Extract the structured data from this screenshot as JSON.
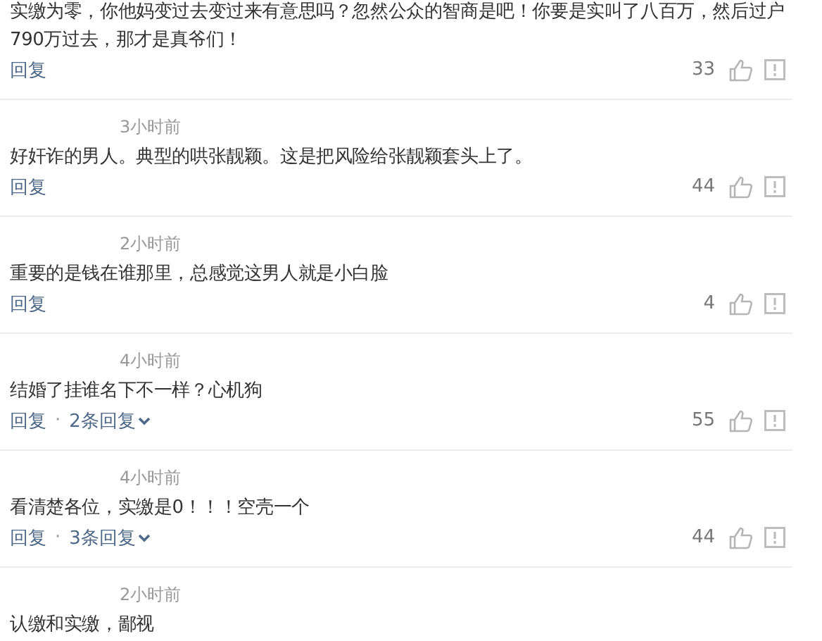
{
  "comments": [
    {
      "text": "实缴为零，你他妈变过去变过来有意思吗？忽然公众的智商是吧！你要是实叫了八百万，然后过户790万过去，那才是真爷们！",
      "reply": "回复",
      "likes": "33"
    },
    {
      "time": "3小时前",
      "text": "好奸诈的男人。典型的哄张靓颖。这是把风险给张靓颖套头上了。",
      "reply": "回复",
      "likes": "44"
    },
    {
      "time": "2小时前",
      "text": "重要的是钱在谁那里，总感觉这男人就是小白脸",
      "reply": "回复",
      "likes": "4"
    },
    {
      "time": "4小时前",
      "text": "结婚了挂谁名下不一样？心机狗",
      "reply": "回复",
      "separator": "·",
      "replies": "2条回复",
      "likes": "55"
    },
    {
      "time": "4小时前",
      "text": "看清楚各位，实缴是0！！！空壳一个",
      "reply": "回复",
      "separator": "·",
      "replies": "3条回复",
      "likes": "44"
    },
    {
      "time": "2小时前",
      "text": "认缴和实缴，鄙视"
    }
  ]
}
